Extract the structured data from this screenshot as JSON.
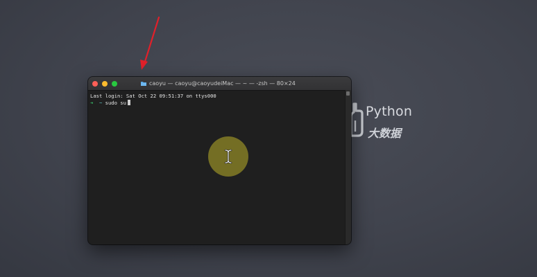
{
  "window": {
    "title": "caoyu — caoyu@caoyudeiMac — ~ — -zsh — 80×24",
    "title_icon": "folder-icon"
  },
  "terminal": {
    "last_login": "Last login: Sat Oct 22 09:51:37 on ttys000",
    "prompt_symbol": "➜",
    "prompt_dir": "~",
    "command": "sudo su"
  },
  "watermark": {
    "text_en": "Python",
    "text_cn": "大数据"
  },
  "colors": {
    "annotation_arrow": "#e0202a",
    "click_highlight": "#aaa028",
    "prompt_arrow": "#39c46b",
    "prompt_dir": "#5fc8c8"
  }
}
